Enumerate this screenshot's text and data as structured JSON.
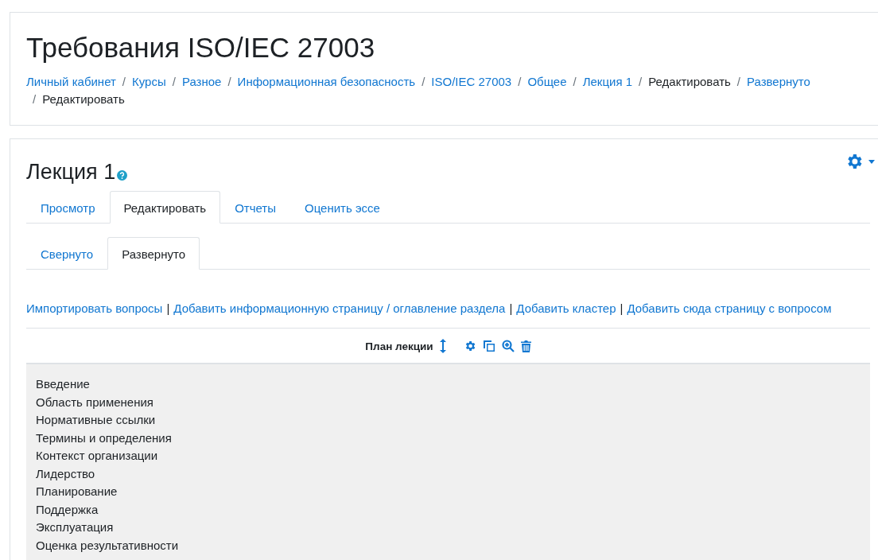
{
  "header": {
    "title": "Требования ISO/IEC 27003",
    "breadcrumb_separator": "/",
    "breadcrumb": [
      {
        "label": "Личный кабинет",
        "kind": "link"
      },
      {
        "label": "Курсы",
        "kind": "link"
      },
      {
        "label": "Разное",
        "kind": "link"
      },
      {
        "label": "Информационная безопасность",
        "kind": "link"
      },
      {
        "label": "ISO/IEC 27003",
        "kind": "link"
      },
      {
        "label": "Общее",
        "kind": "link"
      },
      {
        "label": "Лекция 1",
        "kind": "link"
      },
      {
        "label": "Редактировать",
        "kind": "text"
      },
      {
        "label": "Развернуто",
        "kind": "link"
      },
      {
        "label": "Редактировать",
        "kind": "text"
      }
    ]
  },
  "lesson": {
    "title": "Лекция 1",
    "tabs": [
      {
        "label": "Просмотр",
        "selected": false
      },
      {
        "label": "Редактировать",
        "selected": true
      },
      {
        "label": "Отчеты",
        "selected": false
      },
      {
        "label": "Оценить эссе",
        "selected": false
      }
    ],
    "subtabs": [
      {
        "label": "Свернуто",
        "selected": false
      },
      {
        "label": "Развернуто",
        "selected": true
      }
    ],
    "action_separator": "|",
    "actions": [
      "Импортировать вопросы",
      "Добавить информационную страницу / оглавление раздела",
      "Добавить кластер",
      "Добавить сюда страницу с вопросом"
    ],
    "page": {
      "title": "План лекции",
      "contents": [
        "Введение",
        "Область применения",
        "Нормативные ссылки",
        "Термины и определения",
        "Контекст организации",
        "Лидерство",
        "Планирование",
        "Поддержка",
        "Эксплуатация",
        "Оценка результативности"
      ]
    }
  }
}
